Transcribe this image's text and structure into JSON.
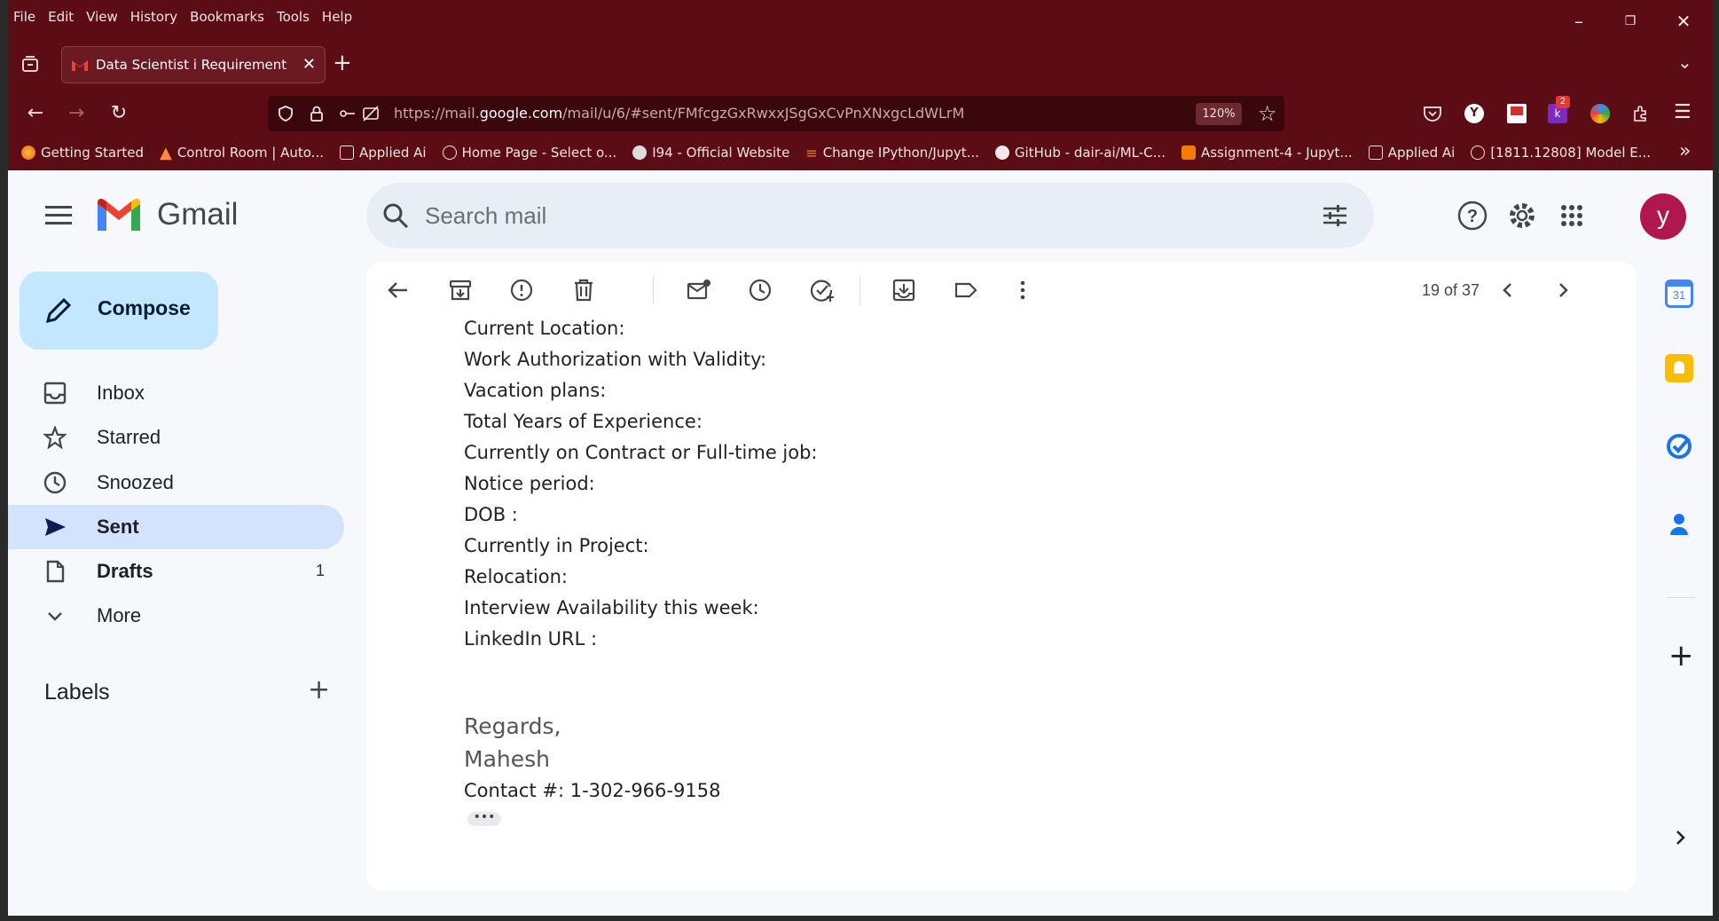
{
  "browser": {
    "menu": [
      "File",
      "Edit",
      "View",
      "History",
      "Bookmarks",
      "Tools",
      "Help"
    ],
    "tab_title": "Data Scientist i Requirement - yk",
    "url_prefix": "https://mail.",
    "url_domain": "google.com",
    "url_rest": "/mail/u/6/#sent/FMfcgzGxRwxxJSgGxCvPnXNxgcLdWLrM",
    "zoom": "120%",
    "notif_badge": "2",
    "bookmarks": [
      "Getting Started",
      "Control Room | Auto...",
      "Applied Ai",
      "Home Page - Select o...",
      "I94 - Official Website",
      "Change IPython/Jupyt...",
      "GitHub - dair-ai/ML-C...",
      "Assignment-4 - Jupyt...",
      "Applied Ai",
      "[1811.12808] Model E..."
    ]
  },
  "gmail": {
    "title": "Gmail",
    "search_placeholder": "Search mail",
    "avatar_letter": "y",
    "compose": "Compose",
    "sidebar": [
      {
        "label": "Inbox",
        "count": ""
      },
      {
        "label": "Starred",
        "count": ""
      },
      {
        "label": "Snoozed",
        "count": ""
      },
      {
        "label": "Sent",
        "count": ""
      },
      {
        "label": "Drafts",
        "count": "1"
      },
      {
        "label": "More",
        "count": ""
      }
    ],
    "labels_heading": "Labels",
    "pagination": "19 of 37",
    "email_lines": [
      "Current Location:",
      "Work Authorization with Validity:",
      "Vacation plans:",
      "Total Years of Experience:",
      "Currently on Contract or Full-time job:",
      "Notice period:",
      "DOB :",
      "Currently in Project:",
      "Relocation:",
      "Interview Availability this week:",
      "LinkedIn URL :"
    ],
    "signature": [
      "Regards,",
      "Mahesh"
    ],
    "contact": "Contact #: 1-302-966-9158",
    "calendar_day": "31",
    "trimmed": "•••"
  },
  "colors": {
    "chrome": "#5c0c14",
    "accent": "#c2e7ff",
    "active": "#d3e3fd",
    "avatar": "#b0174e"
  }
}
